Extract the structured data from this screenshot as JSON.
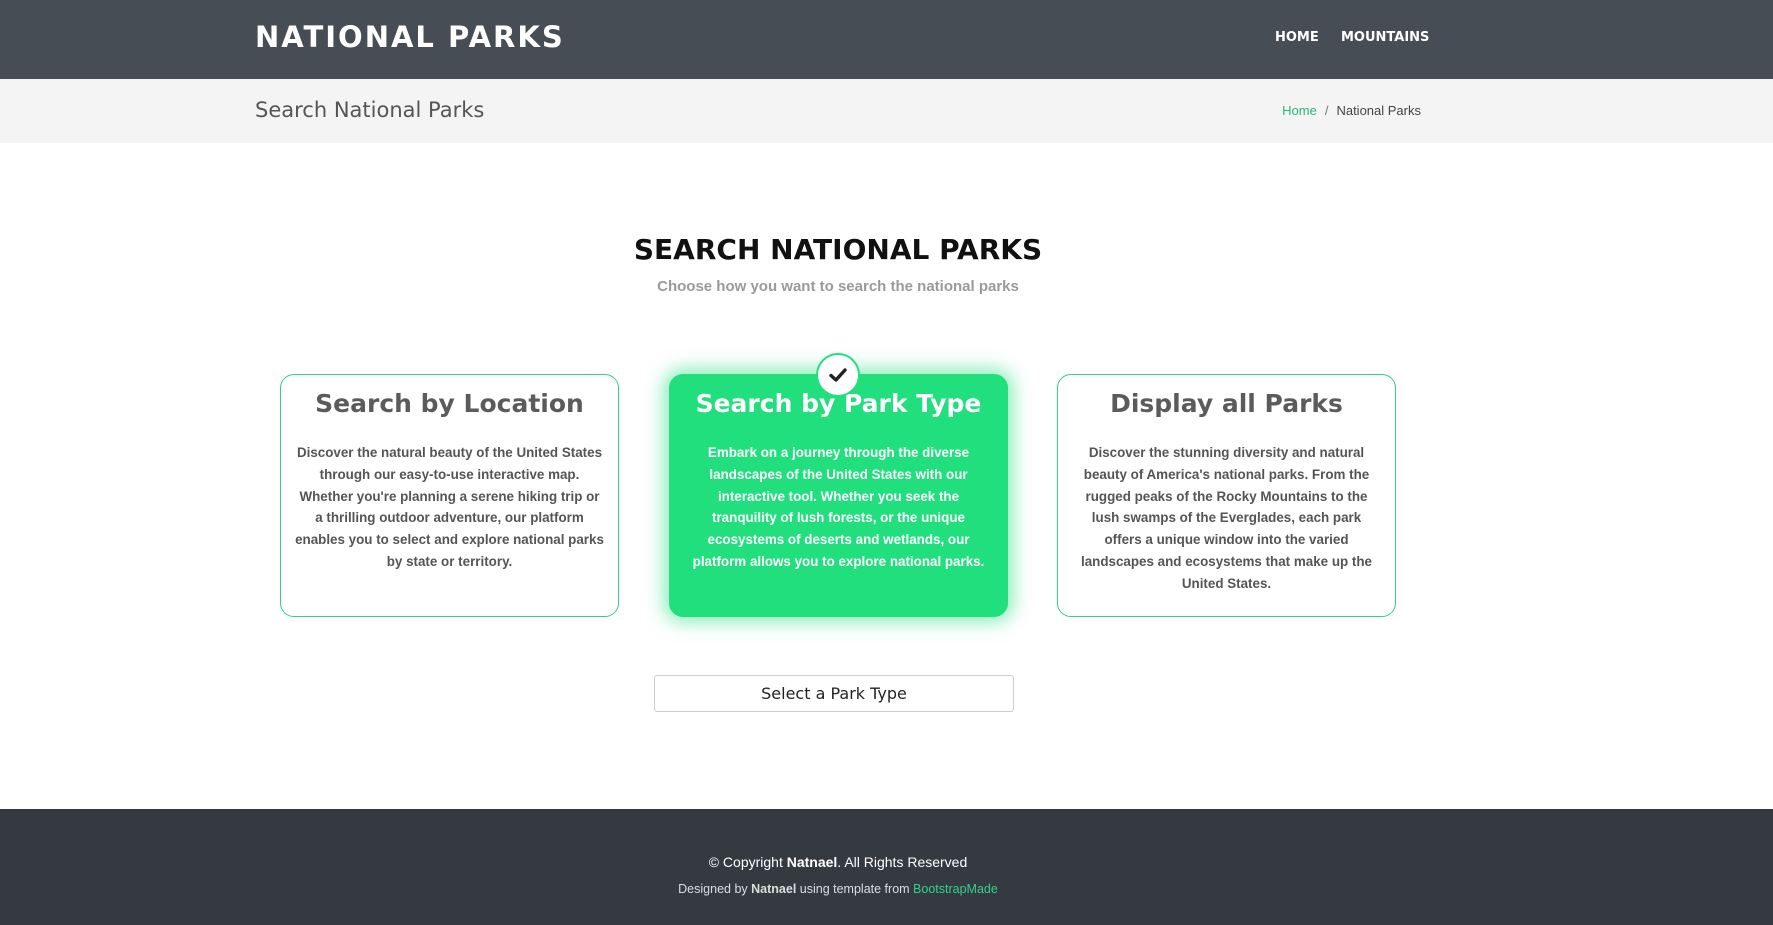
{
  "header": {
    "logo": "NATIONAL PARKS",
    "nav": [
      "HOME",
      "MOUNTAINS"
    ]
  },
  "breadcrumb_bar": {
    "title": "Search National Parks",
    "crumbs": [
      "Home",
      "/",
      "National Parks"
    ]
  },
  "section": {
    "title": "SEARCH NATIONAL PARKS",
    "subtitle": "Choose how you want to search the national parks"
  },
  "cards": [
    {
      "title": "Search by Location",
      "text": "Discover the natural beauty of the United States through our easy-to-use interactive map. Whether you're planning a serene hiking trip or a thrilling outdoor adventure, our platform enables you to select and explore national parks by state or territory."
    },
    {
      "title": "Search by Park Type",
      "text": "Embark on a journey through the diverse landscapes of the United States with our interactive tool. Whether you seek the tranquility of lush forests, or the unique ecosystems of deserts and wetlands, our platform allows you to explore national parks."
    },
    {
      "title": "Display all Parks",
      "text": "Discover the stunning diversity and natural beauty of America's national parks. From the rugged peaks of the Rocky Mountains to the lush swamps of the Everglades, each park offers a unique window into the varied landscapes and ecosystems that make up the United States."
    }
  ],
  "selected_card": "Search by Park Type",
  "selected_icon": "checkmark-icon",
  "select_button": "Select a Park Type",
  "footer": {
    "copyright_prefix": "© Copyright",
    "copyright_name": "Natnael",
    "copyright_suffix": ". All Rights Reserved",
    "designed_prefix": "Designed by",
    "designed_name": "Natnael",
    "designed_middle": "using template from",
    "designed_link": "BootstrapMade"
  },
  "colors": {
    "header_bg": "#474d54",
    "accent_green": "#22df7e",
    "footer_bg": "#353a41"
  }
}
